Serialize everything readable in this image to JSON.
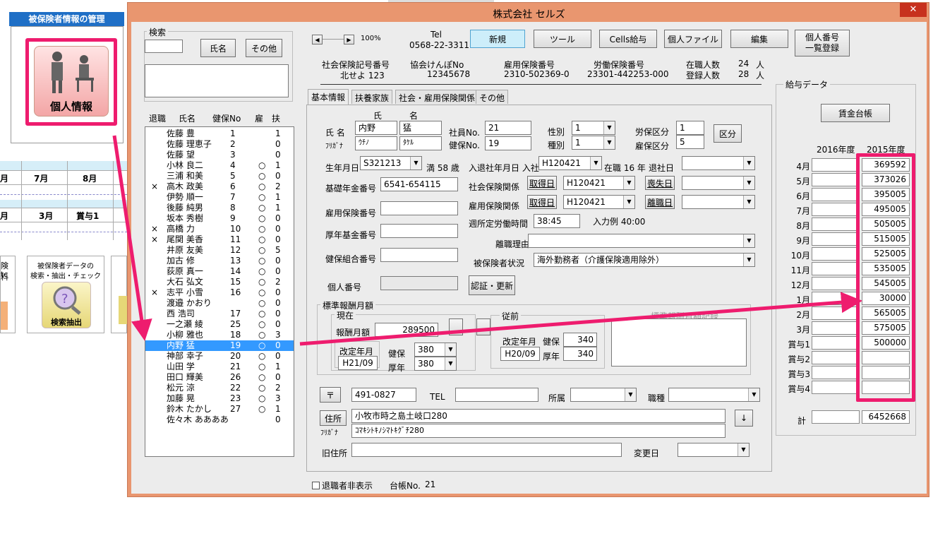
{
  "sheet": {
    "header_title": "被保険者情報の管理",
    "personal_button": "個人情報",
    "grid_row1": [
      "月",
      "7月",
      "8月"
    ],
    "grid_row2": [
      "月",
      "3月",
      "賞与1"
    ],
    "search_panel_title_line1": "被保険者データの",
    "search_panel_title_line2": "検索・抽出・チェック",
    "search_button": "検索抽出",
    "left_card_line1": "険料",
    "left_card_line2": "tc"
  },
  "window": {
    "title": "株式会社 セルズ",
    "close_label": "✕"
  },
  "search": {
    "group_label": "検索",
    "name_button": "氏名",
    "other_button": "その他",
    "input_value": ""
  },
  "list": {
    "headers": [
      "退職",
      "氏名",
      "健保No",
      "雇",
      "扶"
    ],
    "rows": [
      {
        "ret": "",
        "name": "佐藤 豊",
        "no": "1",
        "emp": "",
        "dep": "1"
      },
      {
        "ret": "",
        "name": "佐藤 理恵子",
        "no": "2",
        "emp": "",
        "dep": "0"
      },
      {
        "ret": "",
        "name": "佐藤 望",
        "no": "3",
        "emp": "",
        "dep": "0"
      },
      {
        "ret": "",
        "name": "小林 良二",
        "no": "4",
        "emp": "○",
        "dep": "1"
      },
      {
        "ret": "",
        "name": "三浦 和美",
        "no": "5",
        "emp": "○",
        "dep": "0"
      },
      {
        "ret": "×",
        "name": "高木 政美",
        "no": "6",
        "emp": "○",
        "dep": "2"
      },
      {
        "ret": "",
        "name": "伊勢 順一",
        "no": "7",
        "emp": "○",
        "dep": "1"
      },
      {
        "ret": "",
        "name": "後藤 純男",
        "no": "8",
        "emp": "○",
        "dep": "1"
      },
      {
        "ret": "",
        "name": "坂本 秀樹",
        "no": "9",
        "emp": "○",
        "dep": "0"
      },
      {
        "ret": "×",
        "name": "高橋 力",
        "no": "10",
        "emp": "○",
        "dep": "0"
      },
      {
        "ret": "×",
        "name": "尾関 美香",
        "no": "11",
        "emp": "○",
        "dep": "0"
      },
      {
        "ret": "",
        "name": "井原 友美",
        "no": "12",
        "emp": "○",
        "dep": "5"
      },
      {
        "ret": "",
        "name": "加古 修",
        "no": "13",
        "emp": "○",
        "dep": "0"
      },
      {
        "ret": "",
        "name": "荻原 真一",
        "no": "14",
        "emp": "○",
        "dep": "0"
      },
      {
        "ret": "",
        "name": "大石 弘文",
        "no": "15",
        "emp": "○",
        "dep": "2"
      },
      {
        "ret": "×",
        "name": "志平 小雪",
        "no": "16",
        "emp": "○",
        "dep": "0"
      },
      {
        "ret": "",
        "name": "渡邉 かおり",
        "no": "",
        "emp": "○",
        "dep": "0"
      },
      {
        "ret": "",
        "name": "西 浩司",
        "no": "17",
        "emp": "○",
        "dep": "0"
      },
      {
        "ret": "",
        "name": "一之瀬 綾",
        "no": "25",
        "emp": "○",
        "dep": "0"
      },
      {
        "ret": "",
        "name": "小柳 雅也",
        "no": "18",
        "emp": "○",
        "dep": "3"
      },
      {
        "ret": "",
        "name": "内野 猛",
        "no": "19",
        "emp": "○",
        "dep": "0"
      },
      {
        "ret": "",
        "name": "神部 幸子",
        "no": "20",
        "emp": "○",
        "dep": "0"
      },
      {
        "ret": "",
        "name": "山田 学",
        "no": "21",
        "emp": "○",
        "dep": "1"
      },
      {
        "ret": "",
        "name": "田口 輝美",
        "no": "26",
        "emp": "○",
        "dep": "0"
      },
      {
        "ret": "",
        "name": "松元 涼",
        "no": "22",
        "emp": "○",
        "dep": "2"
      },
      {
        "ret": "",
        "name": "加藤 晃",
        "no": "23",
        "emp": "○",
        "dep": "3"
      },
      {
        "ret": "",
        "name": "鈴木 たかし",
        "no": "27",
        "emp": "○",
        "dep": "1"
      },
      {
        "ret": "",
        "name": "佐々木 ああああ",
        "no": "",
        "emp": "",
        "dep": "0"
      }
    ],
    "selected_index": 20
  },
  "toolbar": {
    "zoom": "100%",
    "tel_label": "Tel",
    "tel_value": "0568-22-3311",
    "new_button": "新規",
    "tool_button": "ツール",
    "cells_button": "Cells給与",
    "file_button": "個人ファイル",
    "edit_button": "編集",
    "mynumber_line1": "個人番号",
    "mynumber_line2": "一覧登録"
  },
  "company": {
    "shaho_label": "社会保険記号番号",
    "shaho_value": "北せよ 123",
    "kyokai_label": "協会けんぽNo",
    "kyokai_value": "12345678",
    "koyo_label": "雇用保険番号",
    "koyo_value": "2310-502369-0",
    "rodo_label": "労働保険番号",
    "rodo_value": "23301-442253-000",
    "zaishoku_label": "在職人数",
    "zaishoku_value": "24",
    "toroku_label": "登録人数",
    "toroku_value": "28",
    "unit": "人"
  },
  "tabs": [
    "基本情報",
    "扶養家族",
    "社会・雇用保険関係",
    "その他"
  ],
  "form": {
    "sei_header": "氏",
    "mei_header": "名",
    "name_label": "氏 名",
    "furigana_label": "ﾌﾘｶﾞﾅ",
    "sei": "内野",
    "mei": "猛",
    "sei_kana": "ｳﾁﾉ",
    "mei_kana": "ﾀｹﾙ",
    "employee_no_label": "社員No.",
    "employee_no": "21",
    "kenpo_no_label": "健保No.",
    "kenpo_no": "19",
    "gender_label": "性別",
    "gender": "1",
    "type_label": "種別",
    "type": "1",
    "rouho_label": "労保区分",
    "rouho": "1",
    "koyo_kbn_label": "雇保区分",
    "koyo_kbn": "5",
    "kubun_button": "区分",
    "birth_label": "生年月日",
    "birth": "S321213",
    "age_text": "満 58 歳",
    "join_label": "入退社年月日 入社",
    "join": "H120421",
    "tenure_text": "在職 16 年",
    "leave_label": "退社日",
    "leave": "",
    "pension_no_label": "基礎年金番号",
    "pension_no": "6541-654115",
    "social_label": "社会保険関係",
    "acquire_button": "取得日",
    "social_acquire": "H120421",
    "lose_button": "喪失日",
    "social_lose": "",
    "emp_ins_no_label": "雇用保険番号",
    "emp_ins_no": "",
    "emp_rel_label": "雇用保険関係",
    "emp_acquire": "H120421",
    "separate_button": "離職日",
    "emp_separate": "",
    "weekly_label": "週所定労働時間",
    "weekly": "38:45",
    "example_text": "入力例 40:00",
    "fund_no_label": "厚年基金番号",
    "fund_no": "",
    "reason_label": "離職理由",
    "reason": "",
    "union_no_label": "健保組合番号",
    "union_no": "",
    "status_label": "被保険者状況",
    "status": "海外勤務者（介護保険適用除外）",
    "mynumber_label": "個人番号",
    "mynumber": "",
    "auth_button": "認証・更新"
  },
  "standard": {
    "title": "標準報酬月額",
    "current_title": "現在",
    "monthly_label": "報酬月額",
    "monthly": "289500",
    "revision_label": "改定年月",
    "revision": "H21/09",
    "kenpo_label": "健保",
    "kenpo": "380",
    "kosei_label": "厚年",
    "kosei": "380",
    "prev_title": "従前",
    "prev_revision_label": "改定年月",
    "prev_revision": "H20/09",
    "prev_kenpo_label": "健保",
    "prev_kenpo": "340",
    "prev_kosei_label": "厚年",
    "prev_kosei": "340",
    "history_title": "標準報酬月額記録"
  },
  "address": {
    "postal_button": "〒",
    "postal": "491-0827",
    "tel_label": "TEL",
    "tel": "",
    "dept_label": "所属",
    "dept": "",
    "job_label": "職種",
    "job": "",
    "address_button": "住所",
    "address": "小牧市時之島土岐口280",
    "furigana_label": "ﾌﾘｶﾞﾅ",
    "address_kana": "ｺﾏｷｼﾄｷﾉｼﾏﾄｷｸﾞﾁ280",
    "down_button": "↓",
    "old_label": "旧住所",
    "old": "",
    "change_label": "変更日",
    "change": ""
  },
  "footer": {
    "hide_retired_label": "退職者非表示",
    "ledger_label": "台帳No.",
    "ledger_no": "21"
  },
  "pay": {
    "group_label": "給与データ",
    "ledger_button": "賃金台帳",
    "year_2016": "2016年度",
    "year_2015": "2015年度",
    "months": [
      "4月",
      "5月",
      "6月",
      "7月",
      "8月",
      "9月",
      "10月",
      "11月",
      "12月",
      "1月",
      "2月",
      "3月",
      "賞与1",
      "賞与2",
      "賞与3",
      "賞与4"
    ],
    "values_2016": [
      "",
      "",
      "",
      "",
      "",
      "",
      "",
      "",
      "",
      "",
      "",
      "",
      "",
      "",
      "",
      ""
    ],
    "values_2015": [
      "369592",
      "373026",
      "395005",
      "495005",
      "505005",
      "515005",
      "525005",
      "535005",
      "545005",
      "30000",
      "565005",
      "575005",
      "500000",
      "",
      "",
      ""
    ],
    "total_label": "計",
    "total_2016": "",
    "total_2015": "6452668"
  },
  "colors": {
    "accent_pink": "#ee1c6e",
    "window_frame": "#e9966f",
    "selected_row": "#3399ff",
    "new_button": "#cdeefa"
  }
}
